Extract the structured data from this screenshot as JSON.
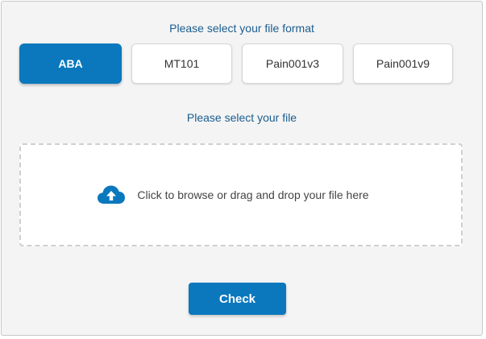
{
  "format_section": {
    "heading": "Please select your file format",
    "options": [
      {
        "label": "ABA",
        "selected": true
      },
      {
        "label": "MT101",
        "selected": false
      },
      {
        "label": "Pain001v3",
        "selected": false
      },
      {
        "label": "Pain001v9",
        "selected": false
      }
    ]
  },
  "file_section": {
    "heading": "Please select your file",
    "dropzone_text": "Click to browse or drag and drop your file here",
    "icon": "cloud-upload-icon"
  },
  "actions": {
    "check_label": "Check"
  },
  "colors": {
    "accent": "#0b78bd",
    "heading": "#1a5d8f",
    "panel_bg": "#f4f4f4"
  }
}
